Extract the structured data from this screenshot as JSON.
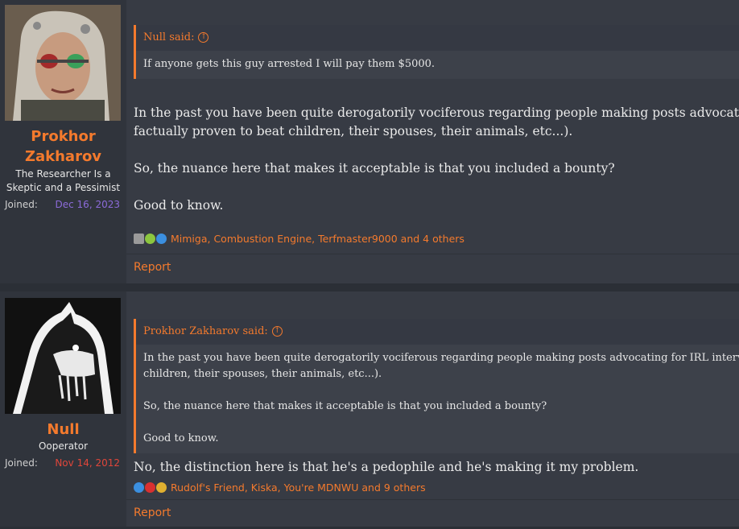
{
  "posts": [
    {
      "author": {
        "name_line1": "Prokhor",
        "name_line2": "Zakharov",
        "title_line1": "The Researcher Is a",
        "title_line2": "Skeptic and a Pessimist",
        "joined_label": "Joined:",
        "joined_date": "Dec 16, 2023",
        "joined_color": "#8c6bd9"
      },
      "quote": {
        "author": "Null said:",
        "lines": [
          "If anyone gets this guy arrested I will pay them $5000."
        ]
      },
      "message": [
        "In the past you have been quite derogatorily vociferous regarding people making posts advocating for",
        "factually proven to beat children, their spouses, their animals, etc...).",
        "So, the nuance here that makes it acceptable is that you included a bounty?",
        "Good to know."
      ],
      "reactions": {
        "icons": [
          "robot-icon",
          "puzzle-icon",
          "thumbs-up-icon"
        ],
        "text": "Mimiga, Combustion Engine, Terfmaster9000 and 4 others"
      },
      "report_label": "Report"
    },
    {
      "author": {
        "name_line1": "Null",
        "title_line1": "Ooperator",
        "joined_label": "Joined:",
        "joined_date": "Nov 14, 2012",
        "joined_color": "#e0463a"
      },
      "quote": {
        "author": "Prokhor Zakharov said:",
        "lines": [
          "In the past you have been quite derogatorily vociferous regarding people making posts advocating for IRL interventio",
          "children, their spouses, their animals, etc...).",
          "",
          "So, the nuance here that makes it acceptable is that you included a bounty?",
          "",
          "Good to know."
        ]
      },
      "message": [
        "No, the distinction here is that he's a pedophile and he's making it my problem."
      ],
      "reactions": {
        "icons": [
          "thumbs-up-icon",
          "heart-icon",
          "medal-icon"
        ],
        "text": "Rudolf's Friend, Kiska, You're MDNWU and 9 others"
      },
      "report_label": "Report"
    }
  ],
  "colors": {
    "accent": "#f47a2d",
    "post_bg": "#373b44",
    "sidebar_bg": "#30343c",
    "page_bg": "#2b2f36"
  }
}
